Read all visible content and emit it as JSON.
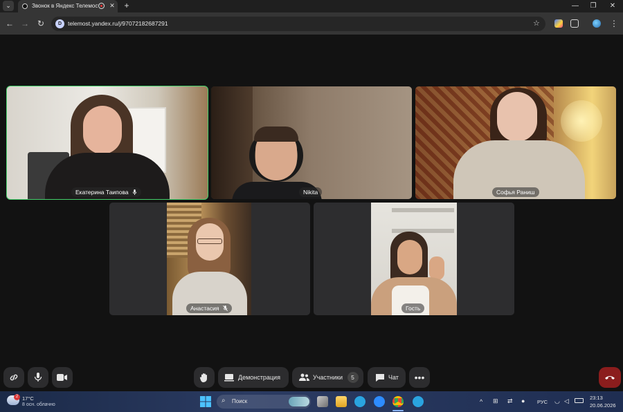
{
  "browser": {
    "tab_title": "Звонок в Яндекс Телемост",
    "url": "telemost.yandex.ru/j/97072182687291"
  },
  "participants": [
    {
      "name": "Екатерина Таипова",
      "mic_icon": "mic-icon"
    },
    {
      "name": "Nikita"
    },
    {
      "name": "Софья Раниш"
    },
    {
      "name": "Анастасия",
      "mic_icon": "mic-muted-icon"
    },
    {
      "name": "Гость"
    }
  ],
  "controls": {
    "screen_share_label": "Демонстрация",
    "participants_label": "Участники",
    "participants_count": "5",
    "chat_label": "Чат"
  },
  "taskbar": {
    "weather_temp": "17°C",
    "weather_desc": "8 осн. облачно",
    "weather_badge": "2",
    "search_placeholder": "Поиск",
    "language": "РУС",
    "time": "23:13",
    "date": "20.06.2026"
  },
  "colors": {
    "active_speaker": "#44d16b",
    "end_call": "#8b1d1d",
    "background": "#121212"
  }
}
